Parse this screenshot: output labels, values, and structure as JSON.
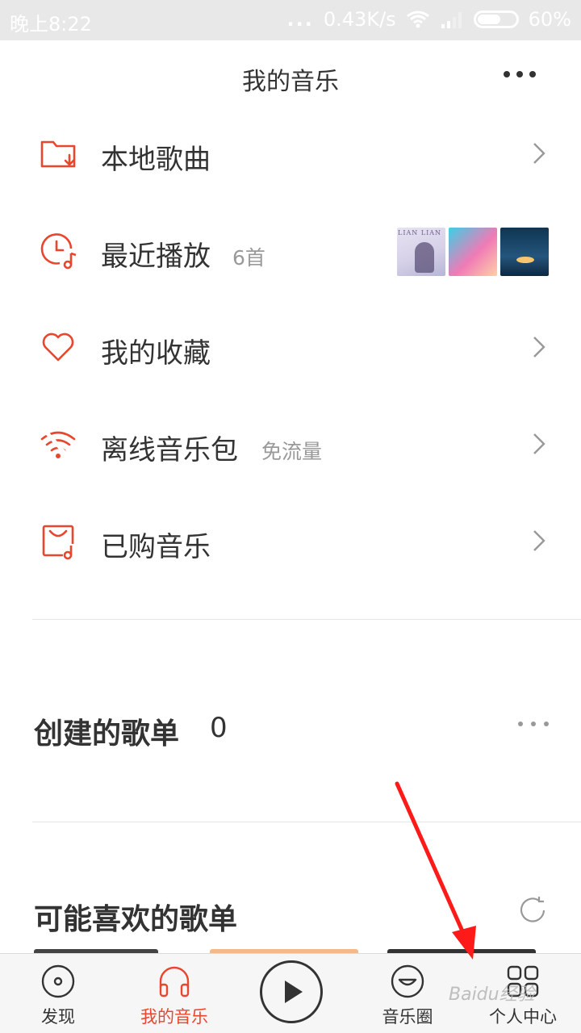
{
  "status_bar": {
    "time": "晚上8:22",
    "net_speed": "0.43K/s",
    "battery_percent": "60%",
    "dots": "...",
    "battery_level": 0.6
  },
  "header": {
    "title": "我的音乐"
  },
  "menu": {
    "items": [
      {
        "label": "本地歌曲",
        "sub": "",
        "icon": "folder-download-icon"
      },
      {
        "label": "最近播放",
        "sub": "6首",
        "icon": "clock-music-icon"
      },
      {
        "label": "我的收藏",
        "sub": "",
        "icon": "heart-icon"
      },
      {
        "label": "离线音乐包",
        "sub": "免流量",
        "icon": "wifi-offline-icon"
      },
      {
        "label": "已购音乐",
        "sub": "",
        "icon": "bag-music-icon"
      }
    ],
    "recent_thumbnails": [
      {
        "caption": "LIAN LIAN"
      },
      {
        "caption": ""
      },
      {
        "caption": ""
      }
    ]
  },
  "created_playlists": {
    "title": "创建的歌单",
    "count": "0"
  },
  "recommended": {
    "title": "可能喜欢的歌单"
  },
  "tabbar": {
    "items": [
      {
        "label": "发现",
        "icon": "disc-icon",
        "active": false
      },
      {
        "label": "我的音乐",
        "icon": "headphones-icon",
        "active": true
      },
      {
        "label": "音乐圈",
        "icon": "smile-icon",
        "active": false
      },
      {
        "label": "个人中心",
        "icon": "grid-icon",
        "active": false
      }
    ]
  },
  "watermark": {
    "text": "Baidu经验"
  },
  "colors": {
    "accent": "#e9462e",
    "annotation_arrow": "#ff1a1a",
    "text": "#333333",
    "muted": "#999999"
  }
}
